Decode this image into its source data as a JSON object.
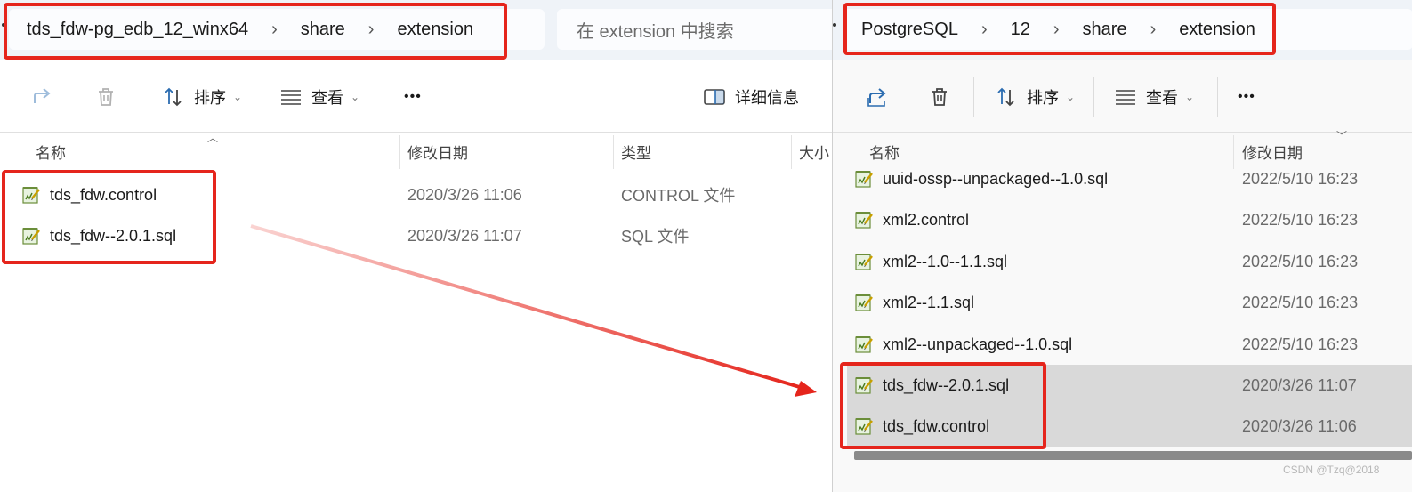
{
  "left_window": {
    "breadcrumb": [
      "tds_fdw-pg_edb_12_winx64",
      "share",
      "extension"
    ],
    "search_placeholder": "在 extension 中搜索",
    "toolbar": {
      "share_icon": "share-icon",
      "delete_icon": "trash-icon",
      "sort_label": "排序",
      "view_label": "查看",
      "more_label": "•••",
      "details_label": "详细信息"
    },
    "columns": {
      "name": "名称",
      "modified": "修改日期",
      "type": "类型",
      "size": "大小"
    },
    "files": [
      {
        "name": "tds_fdw.control",
        "modified": "2020/3/26 11:06",
        "type": "CONTROL 文件"
      },
      {
        "name": "tds_fdw--2.0.1.sql",
        "modified": "2020/3/26 11:07",
        "type": "SQL 文件"
      }
    ]
  },
  "right_window": {
    "breadcrumb": [
      "PostgreSQL",
      "12",
      "share",
      "extension"
    ],
    "toolbar": {
      "share_icon": "share-icon",
      "delete_icon": "trash-icon",
      "sort_label": "排序",
      "view_label": "查看",
      "more_label": "•••"
    },
    "columns": {
      "name": "名称",
      "modified": "修改日期"
    },
    "files": [
      {
        "name": "uuid-ossp--unpackaged--1.0.sql",
        "modified": "2022/5/10 16:23",
        "selected": false
      },
      {
        "name": "xml2.control",
        "modified": "2022/5/10 16:23",
        "selected": false
      },
      {
        "name": "xml2--1.0--1.1.sql",
        "modified": "2022/5/10 16:23",
        "selected": false
      },
      {
        "name": "xml2--1.1.sql",
        "modified": "2022/5/10 16:23",
        "selected": false
      },
      {
        "name": "xml2--unpackaged--1.0.sql",
        "modified": "2022/5/10 16:23",
        "selected": false
      },
      {
        "name": "tds_fdw--2.0.1.sql",
        "modified": "2020/3/26 11:07",
        "selected": true
      },
      {
        "name": "tds_fdw.control",
        "modified": "2020/3/26 11:06",
        "selected": true
      }
    ]
  },
  "watermark": "CSDN @Tzq@2018",
  "colors": {
    "annotation_red": "#e5251c",
    "selection_gray": "#d9d9d9",
    "address_bar_bg": "#eff3f8"
  }
}
